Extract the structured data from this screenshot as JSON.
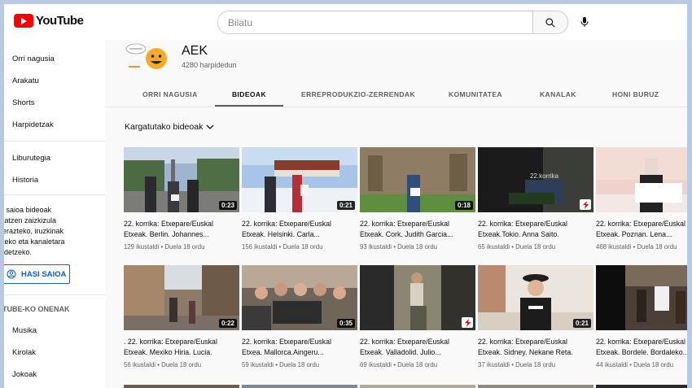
{
  "header": {
    "logo_text": "YouTube",
    "search_placeholder": "Bilatu"
  },
  "sidebar": {
    "items": [
      "Orri nagusia",
      "Arakatu",
      "Shorts",
      "Harpidetzak"
    ],
    "items2": [
      "Liburutegia",
      "Historia"
    ],
    "signin_text": "i saioa bideoak\ntatzen zaizkizula\nerazteko, iruzkinak\nteko eta kanaletara\nidetzeko.",
    "signin_button": "HASI SAIOA",
    "section_title": "TUBE-KO ONENAK",
    "items3": [
      "Musika",
      "Kirolak",
      "Jokoak"
    ]
  },
  "channel": {
    "name": "AEK",
    "subscribers": "4280 harpidedun"
  },
  "tabs": [
    "ORRI NAGUSIA",
    "BIDEOAK",
    "ERREPRODUKZIO-ZERRENDAK",
    "KOMUNITATEA",
    "KANALAK",
    "HONI BURUZ"
  ],
  "section_title": "Kargatutako bideoak",
  "videos": [
    {
      "title": "22. korrika: Etxepare/Euskal\nEtxeak. Berlin. Johannes...",
      "views": "129 ikustaldi",
      "age": "Duela 18 ordu",
      "duration": "0:23"
    },
    {
      "title": "22. korrika: Etxepare/Euskal\nEtxeak. Helsinki. Carla...",
      "views": "156 ikustaldi",
      "age": "Duela 18 ordu",
      "duration": "0:21"
    },
    {
      "title": "22. korrika: Etxepare/Euskal\nEtxeak. Cork. Judith Garcia...",
      "views": "93 ikustaldi",
      "age": "Duela 18 ordu",
      "duration": "0:18"
    },
    {
      "title": "22. korrika: Etxepare/Euskal\nEtxeak.Tokio. Anna Saito.",
      "views": "65 ikustaldi",
      "age": "Duela 18 ordu",
      "duration": ""
    },
    {
      "title": "22. korrika: Etxepare/Euskal\nEtxeak. Poznan. Lena...",
      "views": "468 ikustaldi",
      "age": "Duela 18 ordu",
      "duration": ""
    },
    {
      "title": ". 22. korrika: Etxepare/Euskal\nEtxeak. Mexiko Hiria. Lucia.",
      "views": "56 ikustaldi",
      "age": "Duela 18 ordu",
      "duration": "0:22"
    },
    {
      "title": "22. korrika: Etxepare/Euskal\nEtxea. Mallorca.Aingeru...",
      "views": "59 ikustaldi",
      "age": "Duela 18 ordu",
      "duration": "0:35"
    },
    {
      "title": "22. korrika: Etxepare/Euskal\nEtxeak. Valladolid. Julio...",
      "views": "69 ikustaldi",
      "age": "Duela 18 ordu",
      "duration": ""
    },
    {
      "title": "22. korrika: Etxepare/Euskal\nEtxeak. Sidney. Nekane Reta.",
      "views": "37 ikustaldi",
      "age": "Duela 18 ordu",
      "duration": "0:21"
    },
    {
      "title": "22. korrika: Etxepare/Euskal\nEtxeak. Bordele. Bordaleko...",
      "views": "44 ikustaldi",
      "age": "Duela 18 ordu",
      "duration": ""
    }
  ],
  "meta_separator": "•",
  "colors": {
    "brand_red": "#ff0000",
    "signin_blue": "#065fd4"
  }
}
